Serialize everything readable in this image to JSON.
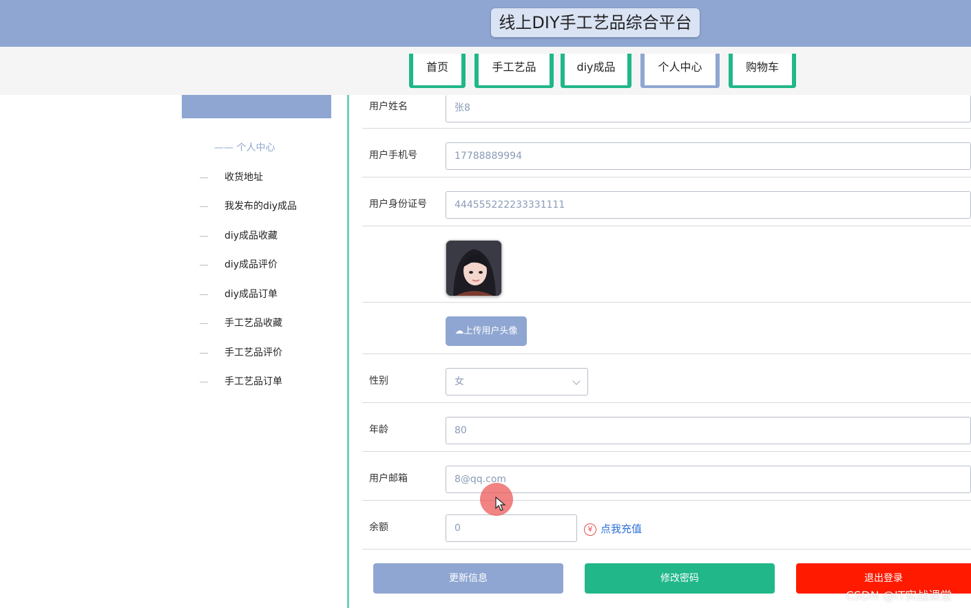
{
  "header": {
    "title": "线上DIY手工艺品综合平台"
  },
  "nav": {
    "items": [
      {
        "label": "首页"
      },
      {
        "label": "手工艺品"
      },
      {
        "label": "diy成品"
      },
      {
        "label": "个人中心"
      },
      {
        "label": "购物车"
      }
    ],
    "active": "个人中心"
  },
  "sidebar": {
    "title": "—— 个人中心",
    "items": [
      {
        "label": "收货地址"
      },
      {
        "label": "我发布的diy成品"
      },
      {
        "label": "diy成品收藏"
      },
      {
        "label": "diy成品评价"
      },
      {
        "label": "diy成品订单"
      },
      {
        "label": "手工艺品收藏"
      },
      {
        "label": "手工艺品评价"
      },
      {
        "label": "手工艺品订单"
      }
    ]
  },
  "form": {
    "name": {
      "label": "用户姓名",
      "value": "张8"
    },
    "phone": {
      "label": "用户手机号",
      "value": "17788889994"
    },
    "id_card": {
      "label": "用户身份证号",
      "value": "444555222233331111"
    },
    "upload_label": "上传用户头像",
    "gender": {
      "label": "性别",
      "value": "女"
    },
    "age": {
      "label": "年龄",
      "value": "80"
    },
    "email": {
      "label": "用户邮箱",
      "value": "8@qq.com"
    },
    "balance": {
      "label": "余额",
      "value": "0",
      "recharge": "点我充值"
    }
  },
  "actions": {
    "update": "更新信息",
    "change_password": "修改密码",
    "logout": "退出登录"
  },
  "watermark": "CSDN @IT实战课堂",
  "colors": {
    "primary": "#8fa6d2",
    "accent": "#21b789",
    "danger": "#ff1a00",
    "link": "#2a6fd6"
  }
}
